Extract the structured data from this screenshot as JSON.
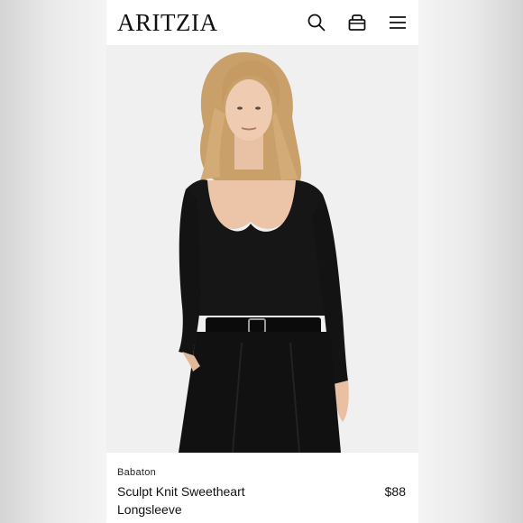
{
  "header": {
    "logo": "ARITZIA",
    "icons": [
      "search-icon",
      "bag-icon",
      "menu-icon"
    ]
  },
  "product": {
    "image": "product-photo",
    "brand": "Babaton",
    "name": "Sculpt Knit Sweetheart Longsleeve",
    "price": "$88"
  },
  "colors": {
    "background": "#ffffff",
    "text": "#111111",
    "garment": "#161616"
  }
}
